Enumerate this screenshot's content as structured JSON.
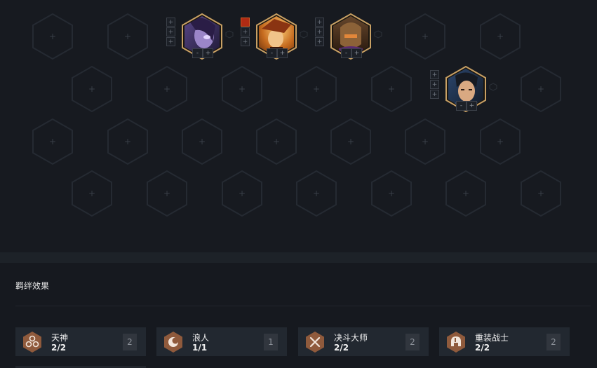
{
  "board": {
    "empty_cell_symbol": "+",
    "units": [
      {
        "name": "unit-1",
        "colors": {
          "bg": "#3d2e5c",
          "accent": "#7c5fb8"
        },
        "items": [
          "+",
          "+",
          "+"
        ],
        "filled_item": false,
        "star": [
          "-",
          "+"
        ]
      },
      {
        "name": "unit-2",
        "colors": {
          "bg": "#7a4a1a",
          "accent": "#e7a84a"
        },
        "items": [
          "",
          "+",
          "+"
        ],
        "filled_item": true,
        "star": [
          "-",
          "+"
        ]
      },
      {
        "name": "unit-3",
        "colors": {
          "bg": "#3a2418",
          "accent": "#8a5a34"
        },
        "items": [
          "+",
          "+",
          "+"
        ],
        "filled_item": false,
        "star": [
          "-",
          "+"
        ]
      },
      {
        "name": "unit-4",
        "colors": {
          "bg": "#1f2e44",
          "accent": "#4a78b4"
        },
        "items": [
          "+",
          "+",
          "+"
        ],
        "filled_item": false,
        "star": [
          "-",
          "+"
        ]
      }
    ]
  },
  "traits": {
    "title": "羁绊效果",
    "items": [
      {
        "name": "天神",
        "count": "2/2",
        "badge": "2",
        "icon": "triad-icon"
      },
      {
        "name": "浪人",
        "count": "1/1",
        "badge": "1",
        "icon": "crescent-icon"
      },
      {
        "name": "决斗大师",
        "count": "2/2",
        "badge": "2",
        "icon": "crossed-swords-icon"
      },
      {
        "name": "重装战士",
        "count": "2/2",
        "badge": "2",
        "icon": "helmet-icon"
      }
    ]
  },
  "colors": {
    "background": "#16191f",
    "hex_stroke": "#252a32",
    "gold_frame": "#c8a064",
    "trait_icon": "#8f5a3c",
    "card_bg": "#222830"
  }
}
